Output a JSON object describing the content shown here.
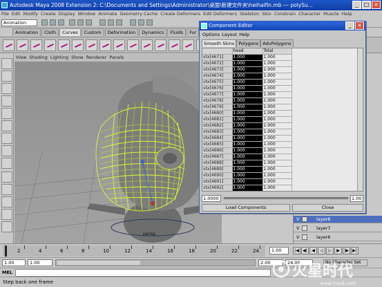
{
  "window": {
    "title": "Autodesk Maya 2008 Extension 2: C:\\Documents and Settings\\Administrator\\桌面\\新建文件夹\\heihaifin.mb  ---  polySu...",
    "minimize": "_",
    "maximize": "□",
    "close": "×"
  },
  "menubar": [
    "File",
    "Edit",
    "Modify",
    "Create",
    "Display",
    "Window",
    "Animate",
    "Geometry Cache",
    "Create Deformers",
    "Edit Deformers",
    "Skeleton",
    "Skin",
    "Constrain",
    "Character",
    "Muscle",
    "Help"
  ],
  "statusline": {
    "mode": "Animation"
  },
  "shelf": {
    "tabs": [
      "Animation",
      "Cloth",
      "Curves",
      "Custom",
      "Deformation",
      "Dynamics",
      "Fluids",
      "Fur",
      "General",
      "Hair"
    ],
    "active_tab": "Curves"
  },
  "viewport": {
    "menu": [
      "View",
      "Shading",
      "Lighting",
      "Show",
      "Renderer",
      "Panels"
    ],
    "camera_label": "persp"
  },
  "component_editor": {
    "title": "Component Editor",
    "menu": [
      "Options",
      "Layout",
      "Help"
    ],
    "tabs": [
      "Smooth Skins",
      "Polygons",
      "AdvPolygons"
    ],
    "active_tab": "Smooth Skins",
    "columns": [
      "",
      "head",
      "Total"
    ],
    "rows": [
      {
        "name": "vtx[4671]",
        "head": "1.000",
        "total": "1.000"
      },
      {
        "name": "vtx[4672]",
        "head": "1.000",
        "total": "1.000"
      },
      {
        "name": "vtx[4673]",
        "head": "1.000",
        "total": "1.000"
      },
      {
        "name": "vtx[4674]",
        "head": "1.000",
        "total": "1.000"
      },
      {
        "name": "vtx[4675]",
        "head": "1.000",
        "total": "1.000"
      },
      {
        "name": "vtx[4676]",
        "head": "1.000",
        "total": "1.000"
      },
      {
        "name": "vtx[4677]",
        "head": "1.000",
        "total": "1.000"
      },
      {
        "name": "vtx[4678]",
        "head": "1.000",
        "total": "1.000"
      },
      {
        "name": "vtx[4679]",
        "head": "1.000",
        "total": "1.000"
      },
      {
        "name": "vtx[4680]",
        "head": "1.000",
        "total": "1.000"
      },
      {
        "name": "vtx[4681]",
        "head": "1.000",
        "total": "1.000"
      },
      {
        "name": "vtx[4682]",
        "head": "1.000",
        "total": "1.000"
      },
      {
        "name": "vtx[4683]",
        "head": "1.000",
        "total": "1.000"
      },
      {
        "name": "vtx[4684]",
        "head": "1.000",
        "total": "1.000"
      },
      {
        "name": "vtx[4685]",
        "head": "1.000",
        "total": "1.000"
      },
      {
        "name": "vtx[4686]",
        "head": "1.000",
        "total": "1.000"
      },
      {
        "name": "vtx[4687]",
        "head": "1.000",
        "total": "1.000"
      },
      {
        "name": "vtx[4688]",
        "head": "1.000",
        "total": "1.000"
      },
      {
        "name": "vtx[4689]",
        "head": "1.000",
        "total": "1.000"
      },
      {
        "name": "vtx[4690]",
        "head": "1.000",
        "total": "1.000"
      },
      {
        "name": "vtx[4691]",
        "head": "1.000",
        "total": "1.000"
      },
      {
        "name": "vtx[4692]",
        "head": "1.000",
        "total": "1.000"
      }
    ],
    "slider_value": "1.0000",
    "slider_max": "1.00",
    "load_button": "Load Components",
    "close_button": "Close"
  },
  "layers": [
    {
      "vis": "V",
      "name": "layer8",
      "selected": true
    },
    {
      "vis": "V",
      "name": "layer7",
      "selected": false
    },
    {
      "vis": "V",
      "name": "layer6",
      "selected": false
    }
  ],
  "timeline": {
    "ticks": [
      "2",
      "4",
      "6",
      "8",
      "10",
      "12",
      "14",
      "16",
      "18",
      "20",
      "22",
      "24"
    ],
    "current_frame": "1.00"
  },
  "range": {
    "start": "1.00",
    "playback_start": "1.00",
    "playback_end": "2.00",
    "end": "24.00",
    "character_set": "No Character Set"
  },
  "command_line": {
    "label": "MEL"
  },
  "help_line": "Step back one frame",
  "watermark": "火星时代",
  "watermark_url": "www.hxsd.com",
  "colors": {
    "title_blue": "#1347b5",
    "wireframe": "#d6ff2a",
    "selected_layer": "#4e6fbd"
  }
}
